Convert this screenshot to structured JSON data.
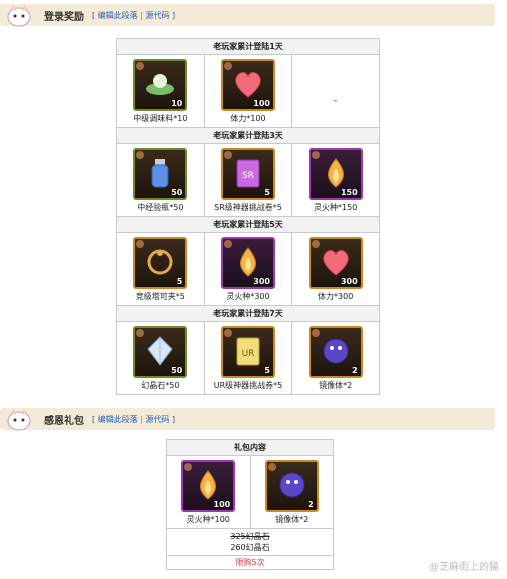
{
  "login_section": {
    "title": "登录奖励",
    "link_edit": "编辑此段落",
    "link_source": "源代码"
  },
  "login_table": [
    {
      "header": "老玩家累计登陆1天",
      "items": [
        {
          "label": "中级调味料*10",
          "qty": "10",
          "icon": "seasoning-icon",
          "frame": "green"
        },
        {
          "label": "体力*100",
          "qty": "100",
          "icon": "heart-icon",
          "frame": "gold"
        },
        {
          "label": "-",
          "qty": null,
          "icon": null,
          "frame": null
        }
      ]
    },
    {
      "header": "老玩家累计登陆3天",
      "items": [
        {
          "label": "中经验瓶*50",
          "qty": "50",
          "icon": "exp-bottle-icon",
          "frame": "green"
        },
        {
          "label": "SR级神器挑战卷*5",
          "qty": "5",
          "icon": "sr-ticket-icon",
          "frame": "gold"
        },
        {
          "label": "灵火种*150",
          "qty": "150",
          "icon": "fire-seed-icon",
          "frame": "purple"
        }
      ]
    },
    {
      "header": "老玩家累计登陆5天",
      "items": [
        {
          "label": "竞级塔可夹*5",
          "qty": "5",
          "icon": "tower-clip-icon",
          "frame": "gold"
        },
        {
          "label": "灵火种*300",
          "qty": "300",
          "icon": "fire-seed-icon",
          "frame": "purple"
        },
        {
          "label": "体力*300",
          "qty": "300",
          "icon": "heart-icon",
          "frame": "gold"
        }
      ]
    },
    {
      "header": "老玩家累计登陆7天",
      "items": [
        {
          "label": "幻晶石*50",
          "qty": "50",
          "icon": "crystal-icon",
          "frame": "green"
        },
        {
          "label": "UR级神器挑战券*5",
          "qty": "5",
          "icon": "ur-ticket-icon",
          "frame": "gold"
        },
        {
          "label": "镜像体*2",
          "qty": "2",
          "icon": "mirror-body-icon",
          "frame": "gold"
        }
      ]
    }
  ],
  "gift_section": {
    "title": "感恩礼包",
    "link_edit": "编辑此段落",
    "link_source": "源代码"
  },
  "gift_table": {
    "header": "礼包内容",
    "items": [
      {
        "label": "灵火种*100",
        "qty": "100",
        "icon": "fire-seed-icon",
        "frame": "purple"
      },
      {
        "label": "镜像体*2",
        "qty": "2",
        "icon": "mirror-body-icon",
        "frame": "gold"
      }
    ],
    "price_old": "325幻晶石",
    "price_new": "260幻晶石",
    "limit": "限购5次"
  },
  "watermark": "@芝麻街上的猫"
}
